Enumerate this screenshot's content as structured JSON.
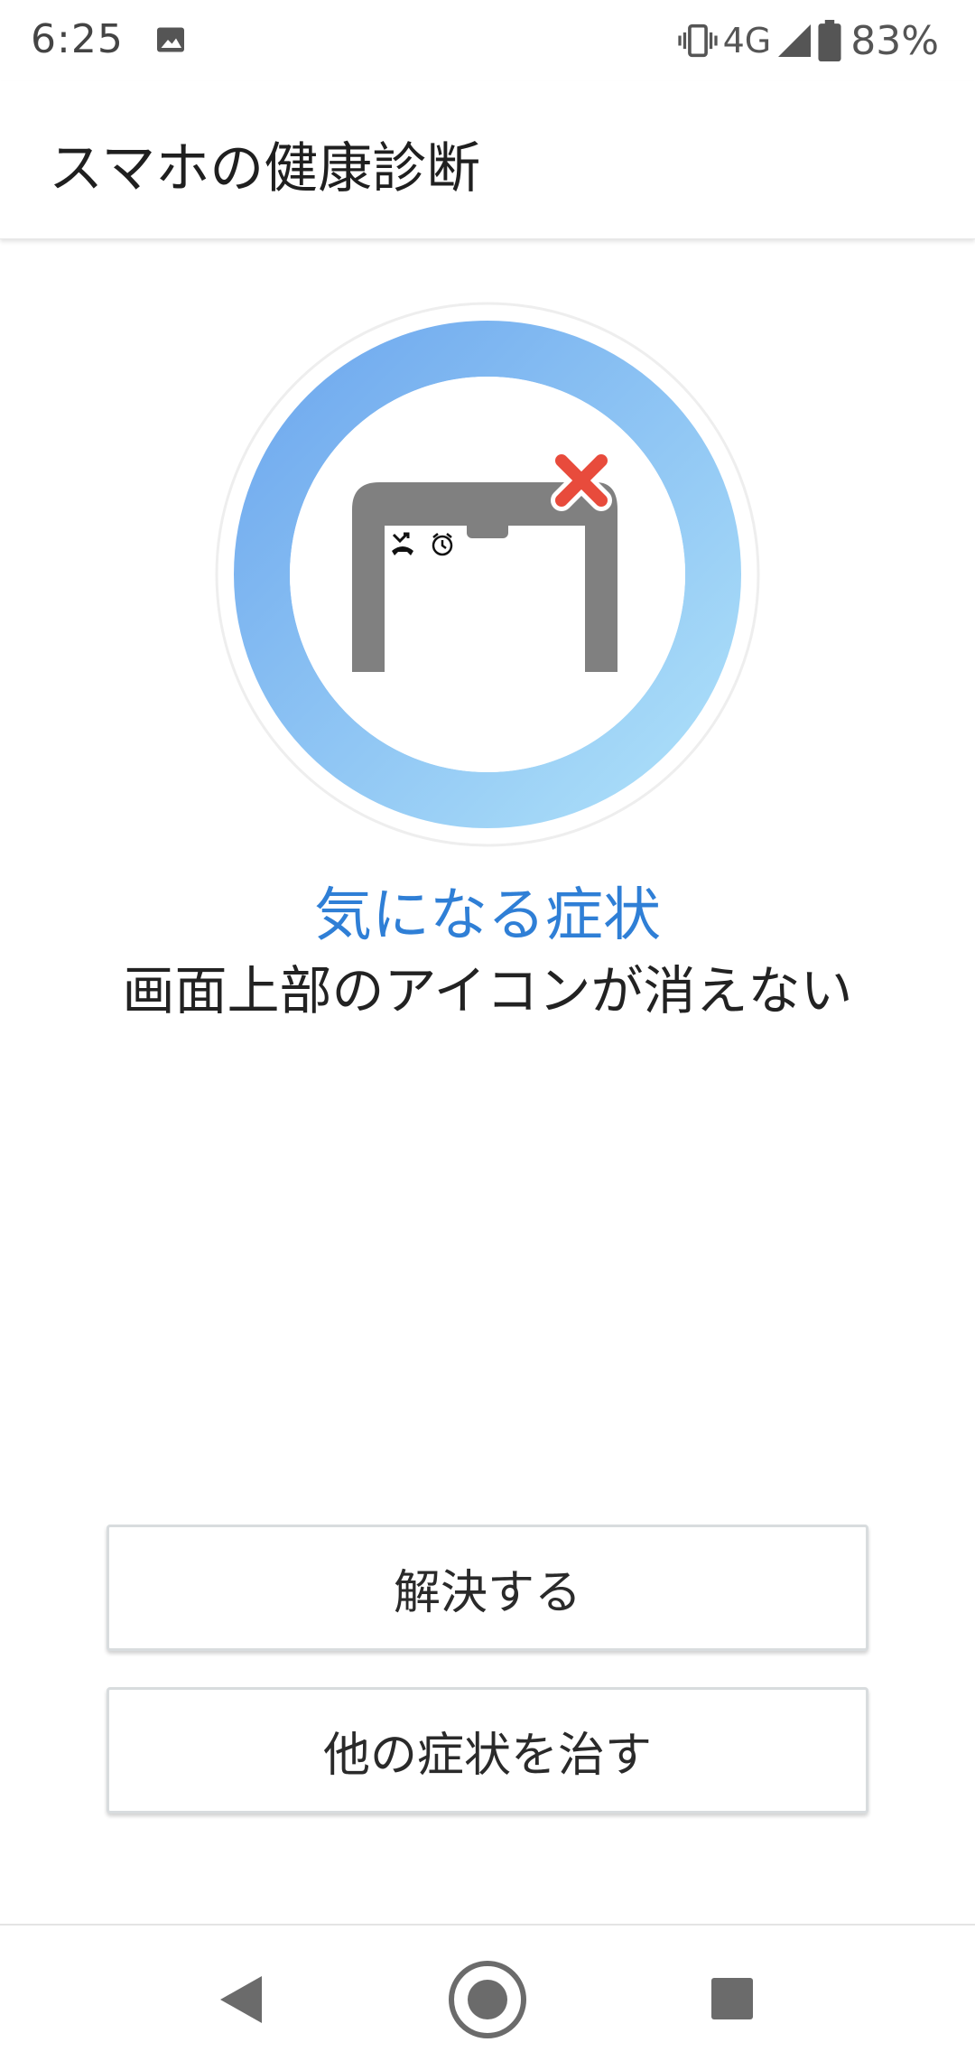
{
  "status_bar": {
    "time": "6:25",
    "network": "4G",
    "battery_percent": "83%",
    "icons": [
      "image-icon",
      "vibrate-icon",
      "signal-icon",
      "battery-icon"
    ]
  },
  "app_bar": {
    "title": "スマホの健康診断"
  },
  "illustration": {
    "ring_color_start": "#74aef0",
    "ring_color_end": "#a9dcf8",
    "phone_color": "#808080",
    "x_mark_color": "#e84b3c",
    "icons": [
      "missed-call-icon",
      "alarm-icon",
      "close-x-icon"
    ]
  },
  "symptom": {
    "label": "気になる症状",
    "description": "画面上部のアイコンが消えない"
  },
  "buttons": {
    "solve": "解決する",
    "other": "他の症状を治す"
  },
  "nav_bar": {
    "icons": [
      "back-icon",
      "home-icon",
      "recents-icon"
    ]
  },
  "colors": {
    "accent": "#2f7fd6"
  }
}
